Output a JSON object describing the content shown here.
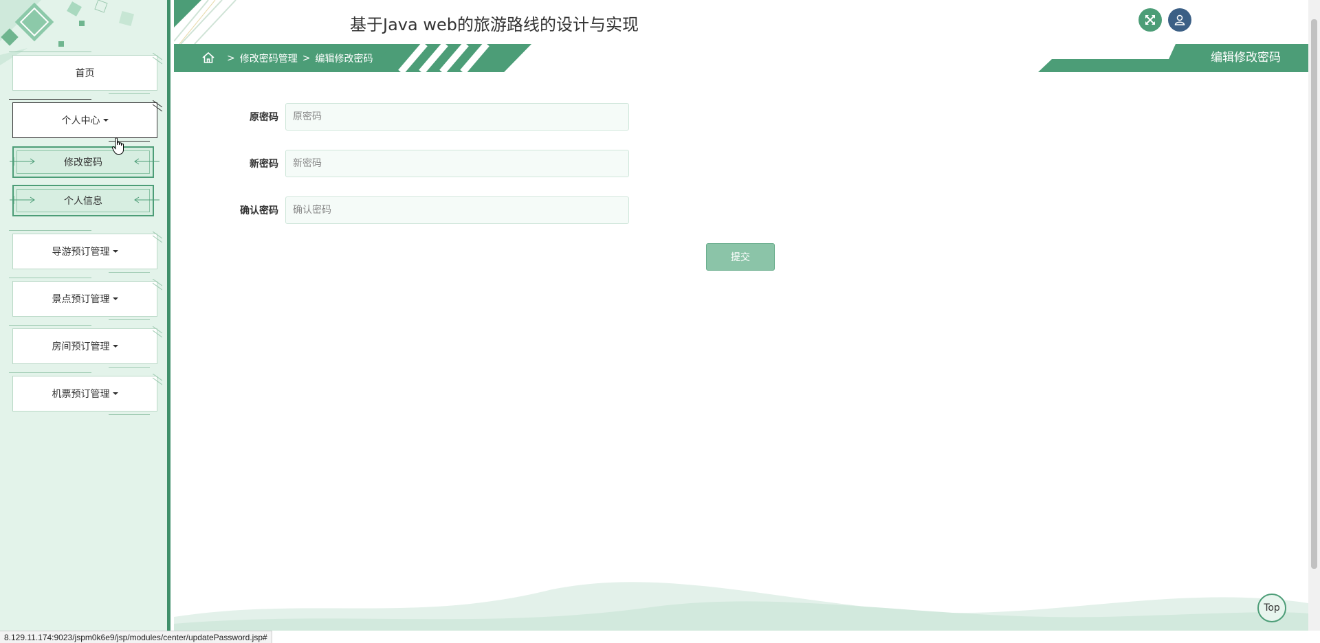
{
  "header": {
    "title": "基于Java web的旅游路线的设计与实现",
    "fullscreen_icon": "expand-icon",
    "user_icon": "user-icon"
  },
  "sidebar": {
    "items": [
      {
        "label": "首页",
        "has_caret": false
      },
      {
        "label": "个人中心",
        "has_caret": true,
        "expanded": true,
        "children": [
          {
            "label": "修改密码"
          },
          {
            "label": "个人信息"
          }
        ]
      },
      {
        "label": "导游预订管理",
        "has_caret": true
      },
      {
        "label": "景点预订管理",
        "has_caret": true
      },
      {
        "label": "房间预订管理",
        "has_caret": true
      },
      {
        "label": "机票预订管理",
        "has_caret": true
      }
    ]
  },
  "breadcrumb": {
    "home_icon": "home-icon",
    "separator": ">",
    "items": [
      "修改密码管理",
      "编辑修改密码"
    ]
  },
  "page_tag": "编辑修改密码",
  "form": {
    "fields": [
      {
        "label": "原密码",
        "placeholder": "原密码",
        "value": ""
      },
      {
        "label": "新密码",
        "placeholder": "新密码",
        "value": ""
      },
      {
        "label": "确认密码",
        "placeholder": "确认密码",
        "value": ""
      }
    ],
    "submit_label": "提交"
  },
  "top_button_label": "Top",
  "status_url": "8.129.11.174:9023/jspm0k6e9/jsp/modules/center/updatePassword.jsp#",
  "colors": {
    "accent": "#4c9d77",
    "sidebar_bg": "#e3f3ea",
    "user_button": "#3b5f85",
    "submit_bg": "#8bc4a8"
  }
}
